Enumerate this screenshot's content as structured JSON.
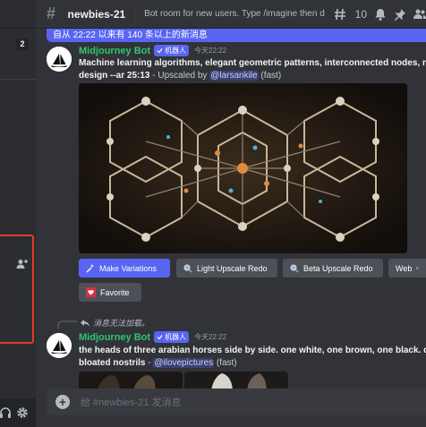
{
  "header": {
    "channel": "newbies-21",
    "topic": "Bot room for new users. Type /imagine then descri…",
    "thread_count": "10"
  },
  "sidebar": {
    "badge": "2"
  },
  "new_messages_bar": "自从 22:22 以来有 140 条以上的新消息",
  "message1": {
    "author": "Midjourney Bot",
    "bot_tag": "机器人",
    "time": "今天22:22",
    "prompt": "Machine learning algorithms, elegant geometric patterns, interconnected nodes, n",
    "prompt_line2": "design --ar 25:13",
    "suffix": " - Upscaled by ",
    "mention": "@larsankile",
    "speed": " (fast)",
    "buttons": {
      "make_variations": "Make Variations",
      "light_upscale": "Light Upscale Redo",
      "beta_upscale": "Beta Upscale Redo",
      "web": "Web",
      "favorite": "Favorite"
    }
  },
  "reply_preview": "消息无法加载。",
  "message2": {
    "author": "Midjourney Bot",
    "bot_tag": "机器人",
    "time": "今天22:22",
    "prompt": "the heads of three arabian horses side by side. one white, one brown, one black. de",
    "prompt_line2": "bloated nostrils",
    "separator": " - ",
    "mention": "@ilovepictures",
    "speed": " (fast)"
  },
  "composer": {
    "placeholder": "给 #newbies-21 发消息"
  },
  "colors": {
    "background": "#313338",
    "sidebar": "#2b2d31",
    "blurple": "#5865f2",
    "bot_name": "#2dc770",
    "button": "#4e5058",
    "highlight_box": "#e03c2e"
  },
  "icons": [
    "hash-icon",
    "threads-icon",
    "bell-icon",
    "pin-icon",
    "members-icon",
    "add-user-icon",
    "headset-icon",
    "gear-icon",
    "sparkle-icon",
    "search-icon",
    "heart-icon",
    "external-link-icon",
    "reply-icon",
    "plus-icon",
    "checkmark-icon"
  ]
}
